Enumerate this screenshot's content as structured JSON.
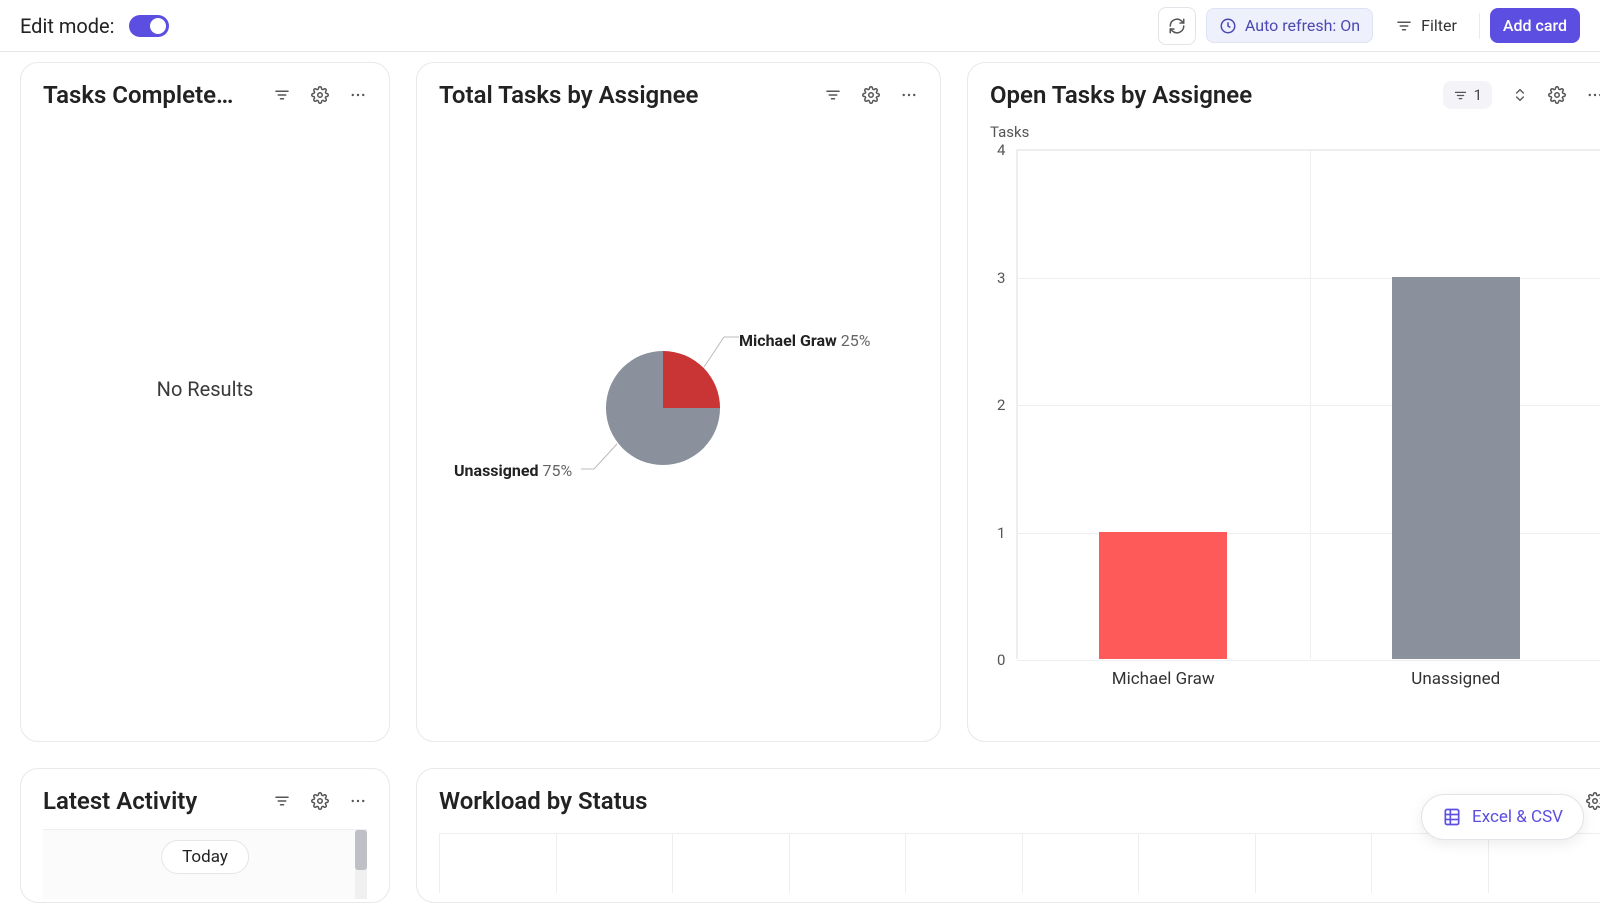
{
  "topbar": {
    "edit_mode_label": "Edit mode:",
    "auto_refresh_label": "Auto refresh: On",
    "filter_label": "Filter",
    "add_card_label": "Add card"
  },
  "cards": {
    "tasks_completed": {
      "title": "Tasks Complete…",
      "no_results": "No Results"
    },
    "total_tasks": {
      "title": "Total Tasks by Assignee",
      "label1_name": "Michael Graw",
      "label1_pct": "25%",
      "label2_name": "Unassigned",
      "label2_pct": "75%"
    },
    "open_tasks": {
      "title": "Open Tasks by Assignee",
      "filter_count": "1",
      "ylabel": "Tasks"
    },
    "latest_activity": {
      "title": "Latest Activity",
      "today": "Today"
    },
    "workload": {
      "title": "Workload by Status"
    }
  },
  "export_label": "Excel & CSV",
  "chart_data": [
    {
      "type": "pie",
      "title": "Total Tasks by Assignee",
      "series": [
        {
          "name": "Michael Graw",
          "value": 25,
          "color": "#c93434"
        },
        {
          "name": "Unassigned",
          "value": 75,
          "color": "#8a919d"
        }
      ]
    },
    {
      "type": "bar",
      "title": "Open Tasks by Assignee",
      "ylabel": "Tasks",
      "ylim": [
        0,
        4
      ],
      "categories": [
        "Michael Graw",
        "Unassigned"
      ],
      "values": [
        1,
        3
      ],
      "colors": [
        "#ff5a5a",
        "#8a919d"
      ]
    }
  ]
}
